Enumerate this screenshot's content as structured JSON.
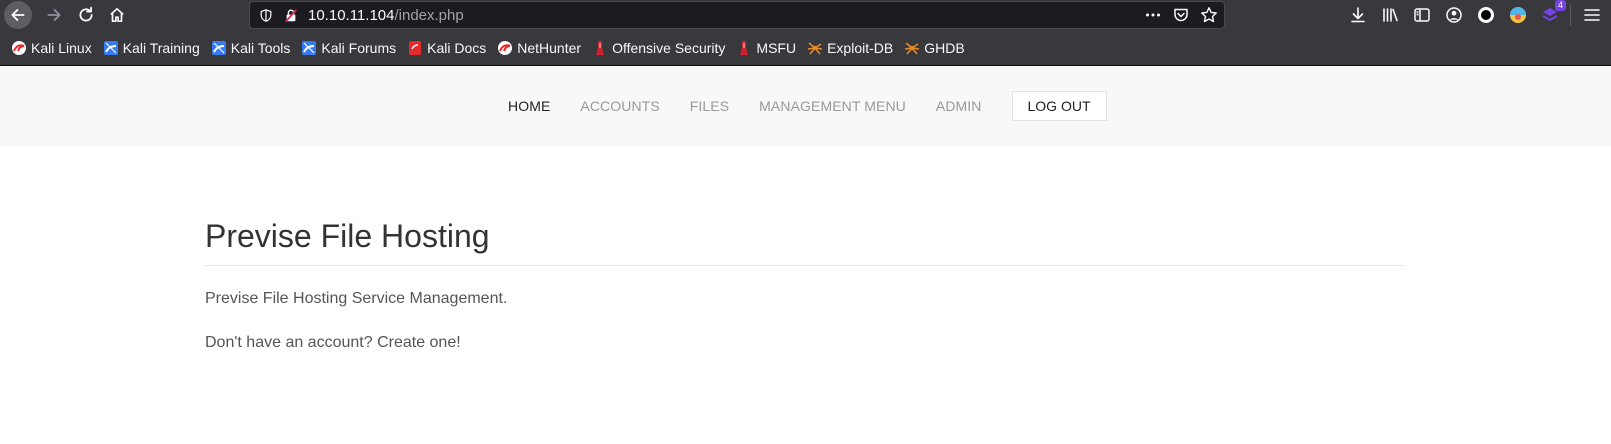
{
  "browser": {
    "url_host": "10.10.11.104",
    "url_path": "/index.php",
    "extension_badge": "4"
  },
  "bookmarks": [
    {
      "label": "Kali Linux",
      "icon": "kali-dragon-icon"
    },
    {
      "label": "Kali Training",
      "icon": "kali-training-icon"
    },
    {
      "label": "Kali Tools",
      "icon": "kali-tools-icon"
    },
    {
      "label": "Kali Forums",
      "icon": "kali-forums-icon"
    },
    {
      "label": "Kali Docs",
      "icon": "kali-docs-icon"
    },
    {
      "label": "NetHunter",
      "icon": "nethunter-icon"
    },
    {
      "label": "Offensive Security",
      "icon": "offsec-icon"
    },
    {
      "label": "MSFU",
      "icon": "msfu-icon"
    },
    {
      "label": "Exploit-DB",
      "icon": "exploitdb-icon"
    },
    {
      "label": "GHDB",
      "icon": "ghdb-icon"
    }
  ],
  "site_nav": {
    "items": [
      "HOME",
      "ACCOUNTS",
      "FILES",
      "MANAGEMENT MENU",
      "ADMIN"
    ],
    "logout": "LOG OUT"
  },
  "main": {
    "title": "Previse File Hosting",
    "description": "Previse File Hosting Service Management.",
    "signup_text": "Don't have an account? Create one!"
  },
  "colors": {
    "chrome_bg": "#38383d",
    "urlbar_bg": "#1c1b22",
    "nav_bg": "#f8f8f8",
    "nav_active": "#222222",
    "nav_inactive": "#999999",
    "title_text": "#333333",
    "body_text": "#555555"
  }
}
